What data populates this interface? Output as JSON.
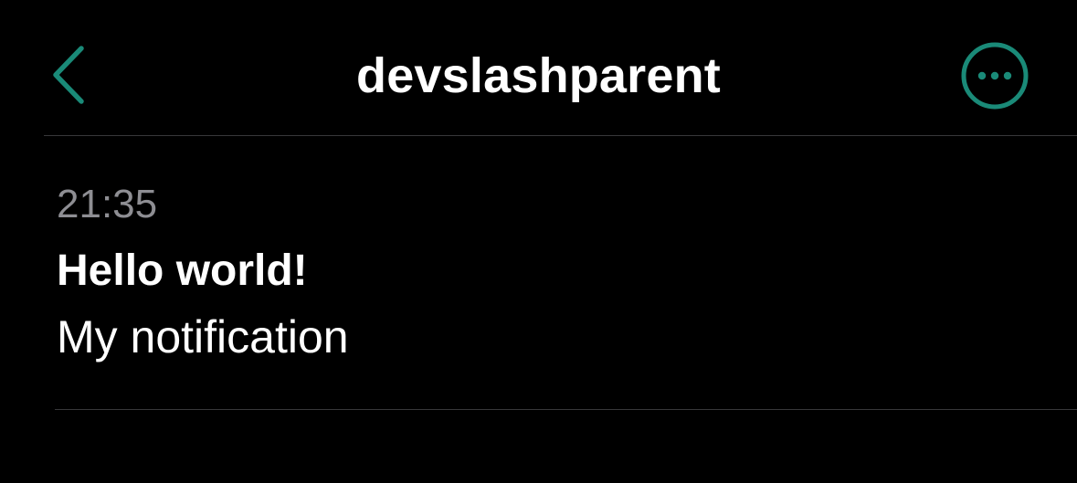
{
  "nav": {
    "title": "devslashparent",
    "back_icon": "chevron-left-icon",
    "more_icon": "ellipsis-circle-icon"
  },
  "notification": {
    "time": "21:35",
    "title": "Hello world!",
    "body": "My notification"
  },
  "colors": {
    "accent": "#1a8a78",
    "background": "#000000",
    "text_primary": "#ffffff",
    "text_secondary": "#8e8e93",
    "separator": "#38383a"
  }
}
